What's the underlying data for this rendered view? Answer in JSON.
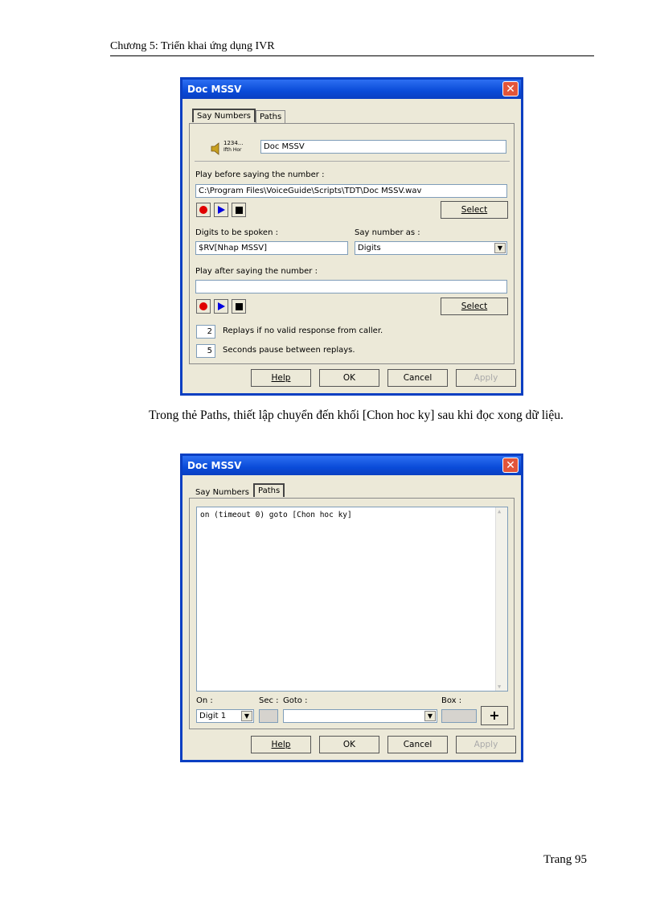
{
  "page": {
    "header": "Chương 5: Triển khai ứng dụng IVR",
    "paragraph": "Trong thẻ Paths, thiết lập chuyển đến khối [Chon hoc ky] sau khi đọc xong dữ liệu.",
    "footer": "Trang 95"
  },
  "dialog1": {
    "title": "Doc MSSV",
    "close_glyph": "✕",
    "tabs": [
      "Say Numbers",
      "Paths"
    ],
    "icon_text": [
      "1234...",
      "Ifth Hor"
    ],
    "name_value": "Doc MSSV",
    "play_before_label": "Play before saying the number :",
    "play_before_value": "C:\\Program Files\\VoiceGuide\\Scripts\\TDT\\Doc MSSV.wav",
    "select_label": "Select",
    "digits_label": "Digits to be spoken :",
    "digits_value": "$RV[Nhap MSSV]",
    "say_as_label": "Say number as :",
    "say_as_value": "Digits",
    "play_after_label": "Play after saying the number :",
    "play_after_value": "",
    "replays_value": "2",
    "replays_label": "Replays if no valid response from caller.",
    "pause_value": "5",
    "pause_label": "Seconds pause between replays.",
    "buttons": [
      "Help",
      "OK",
      "Cancel",
      "Apply"
    ]
  },
  "dialog2": {
    "title": "Doc MSSV",
    "close_glyph": "✕",
    "tabs": [
      "Say Numbers",
      "Paths"
    ],
    "paths_text": "on (timeout 0) goto [Chon hoc ky]",
    "on_label": "On :",
    "on_value": "Digit 1",
    "sec_label": "Sec :",
    "goto_label": "Goto :",
    "goto_value": "",
    "box_label": "Box :",
    "add_glyph": "+",
    "buttons": [
      "Help",
      "OK",
      "Cancel",
      "Apply"
    ]
  },
  "colors": {
    "titlebar": "#0a4bd8",
    "record": "#e00000",
    "play": "#0000e0",
    "stop": "#000000"
  }
}
